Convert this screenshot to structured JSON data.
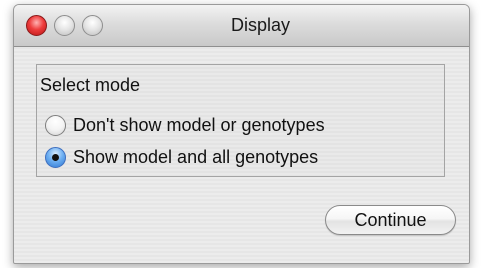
{
  "window": {
    "title": "Display",
    "controls": [
      "close-icon",
      "minimize-icon",
      "zoom-icon"
    ]
  },
  "group": {
    "label": "Select mode",
    "options": [
      {
        "label": "Don't show model or genotypes",
        "selected": false
      },
      {
        "label": "Show model and all genotypes",
        "selected": true
      }
    ]
  },
  "buttons": {
    "continue_label": "Continue"
  },
  "colors": {
    "close": "#ee3d3d",
    "radio_selected": "#2e78d2"
  }
}
